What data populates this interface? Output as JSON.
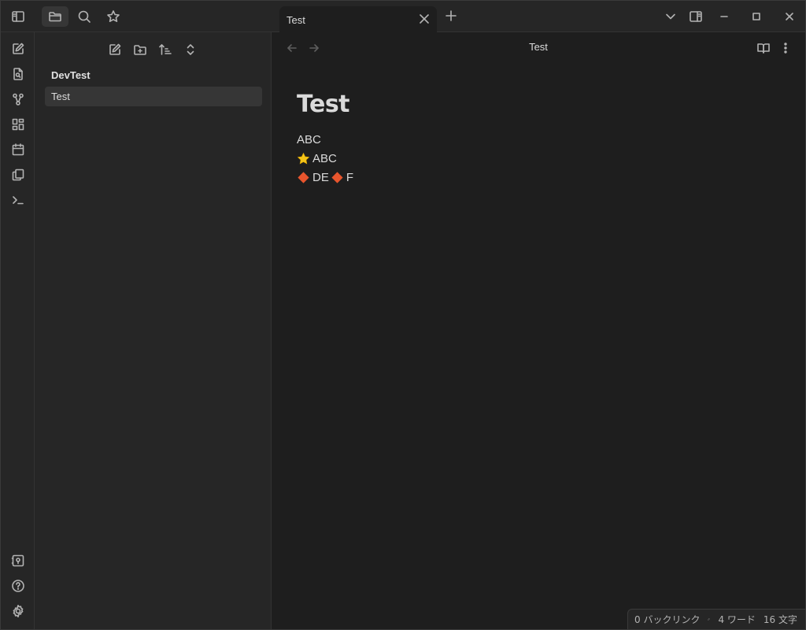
{
  "titlebar": {
    "tab_title": "Test"
  },
  "sidebar": {
    "vault_name": "DevTest",
    "files": [
      "Test"
    ]
  },
  "view": {
    "title": "Test"
  },
  "note": {
    "heading": "Test",
    "lines": [
      "ABC",
      "ABC",
      "DE",
      "F"
    ]
  },
  "status": {
    "backlinks": "0 バックリンク",
    "words": "4 ワード",
    "chars": "16 文字"
  },
  "colors": {
    "background": "#1e1e1e",
    "panel": "#262626",
    "accent_star": "#f5c518",
    "accent_diamond": "#e8552d"
  },
  "icons": {
    "sidebar_toggle": "sidebar-toggle-icon",
    "files": "folder-icon",
    "search": "search-icon",
    "bookmarks": "star-icon"
  }
}
